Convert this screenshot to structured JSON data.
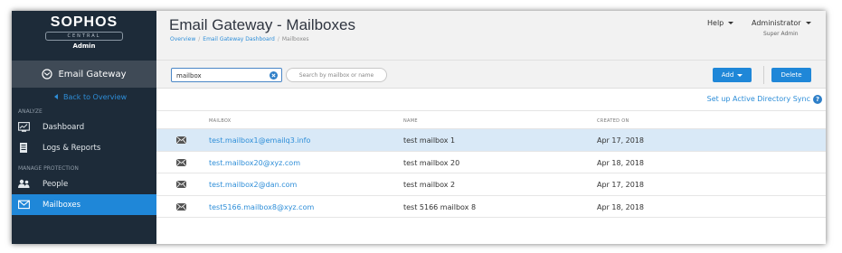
{
  "sidebar": {
    "brand": {
      "name": "SOPHOS",
      "central": "CENTRAL",
      "subtitle": "Admin"
    },
    "product": {
      "label": "Email Gateway",
      "icon": "email-gateway-icon"
    },
    "back_link": "Back to Overview",
    "sections": [
      {
        "label": "ANALYZE",
        "items": [
          {
            "label": "Dashboard",
            "icon": "dashboard-icon",
            "active": false
          },
          {
            "label": "Logs & Reports",
            "icon": "logs-icon",
            "active": false
          }
        ]
      },
      {
        "label": "MANAGE PROTECTION",
        "items": [
          {
            "label": "People",
            "icon": "people-icon",
            "active": false
          },
          {
            "label": "Mailboxes",
            "icon": "mailbox-icon",
            "active": true
          }
        ]
      }
    ]
  },
  "header": {
    "title": "Email Gateway - Mailboxes",
    "breadcrumb": [
      "Overview",
      "Email Gateway Dashboard",
      "Mailboxes"
    ],
    "help_label": "Help",
    "user_name": "Administrator",
    "user_role": "Super Admin"
  },
  "toolbar": {
    "search_value": "mailbox",
    "search_mode": "Search by mailbox or name",
    "add_label": "Add",
    "delete_label": "Delete"
  },
  "sync_link": "Set up Active Directory Sync",
  "table": {
    "columns": [
      "MAILBOX",
      "NAME",
      "CREATED ON"
    ],
    "rows": [
      {
        "mailbox": "test.mailbox1@emailq3.info",
        "name": "test mailbox 1",
        "created": "Apr 17, 2018",
        "selected": true
      },
      {
        "mailbox": "test.mailbox20@xyz.com",
        "name": "test mailbox 20",
        "created": "Apr 18, 2018",
        "selected": false
      },
      {
        "mailbox": "test.mailbox2@dan.com",
        "name": "test mailbox 2",
        "created": "Apr 17, 2018",
        "selected": false
      },
      {
        "mailbox": "test5166.mailbox8@xyz.com",
        "name": "test 5166 mailbox 8",
        "created": "Apr 18, 2018",
        "selected": false
      }
    ]
  },
  "colors": {
    "sidebar_bg": "#1d2b39",
    "accent": "#1f87d8",
    "selected_row": "#d9e9f7",
    "link": "#2e8ed8"
  }
}
